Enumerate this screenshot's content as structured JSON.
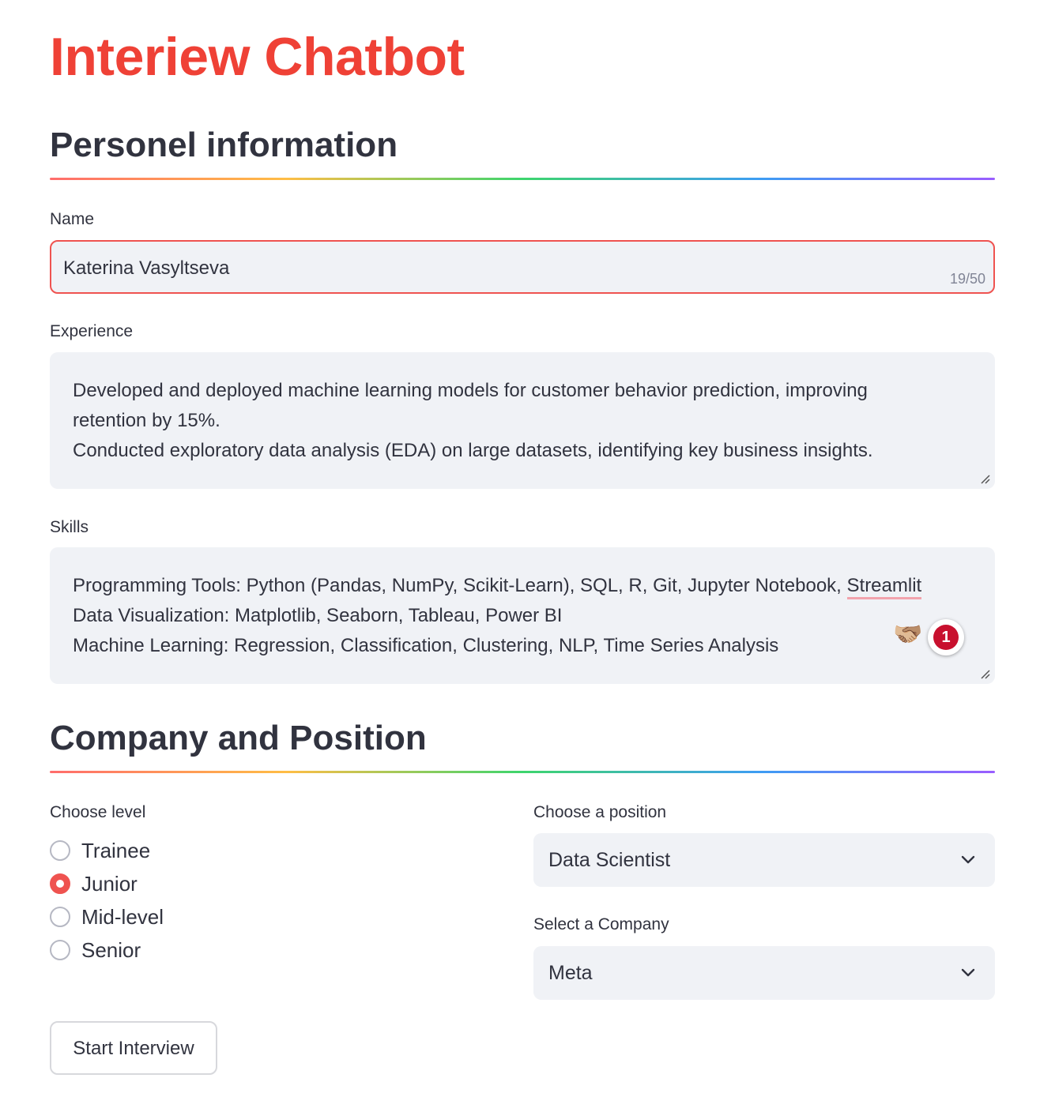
{
  "app": {
    "title": "Interiew Chatbot"
  },
  "personal": {
    "heading": "Personel information",
    "name": {
      "label": "Name",
      "value": "Katerina Vasyltseva",
      "counter": "19/50"
    },
    "experience": {
      "label": "Experience",
      "lines": [
        "Developed and deployed machine learning models for customer behavior prediction, improving",
        "retention by 15%.",
        "Conducted exploratory data analysis (EDA) on large datasets, identifying key business insights."
      ]
    },
    "skills": {
      "label": "Skills",
      "line1_prefix": "Programming Tools: Python (Pandas, NumPy, Scikit-Learn), SQL, R, Git, Jupyter Notebook, ",
      "line1_flagged": "Streamlit",
      "line2": "Data Visualization: Matplotlib, Seaborn, Tableau, Power BI",
      "line3": "Machine Learning: Regression, Classification, Clustering, NLP, Time Series Analysis",
      "assistant_emoji": "🫱🏼‍🫲🏽",
      "issue_count": "1"
    }
  },
  "company": {
    "heading": "Company and Position",
    "level": {
      "label": "Choose level",
      "options": [
        "Trainee",
        "Junior",
        "Mid-level",
        "Senior"
      ],
      "selected": "Junior"
    },
    "position": {
      "label": "Choose a position",
      "value": "Data Scientist"
    },
    "company_select": {
      "label": "Select a Company",
      "value": "Meta"
    }
  },
  "actions": {
    "start_label": "Start Interview"
  },
  "colors": {
    "accent": "#ef4136",
    "radio": "#ef5350",
    "input_bg": "#f0f2f6",
    "text": "#31333f"
  },
  "icons": {
    "select": "chevron-down-icon",
    "resize": "resize-handle-icon"
  }
}
